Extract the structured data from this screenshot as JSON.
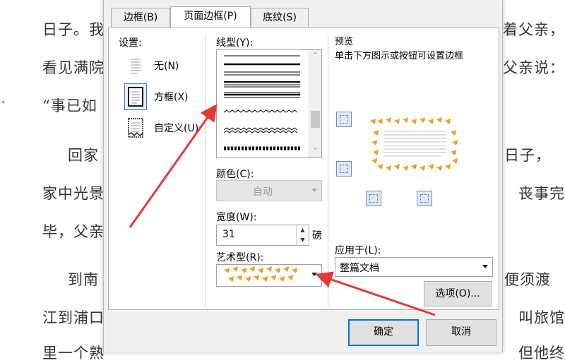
{
  "background_doc": {
    "lines": [
      {
        "left": "日子。我",
        "right": "着父亲，"
      },
      {
        "left": "看见满院",
        "right": "父亲说："
      },
      {
        "left": "“事已如",
        "right": ""
      },
      {
        "left": "回家",
        "right": "日子，"
      },
      {
        "left": "家中光景",
        "right": "丧事完"
      },
      {
        "left": "毕，父亲",
        "right": ""
      },
      {
        "left": "到南",
        "right": "便须渡"
      },
      {
        "left": "江到浦口",
        "right": "叫旅馆"
      },
      {
        "left": "里一个熟",
        "right": "但他终"
      }
    ]
  },
  "tabs": [
    {
      "label": "边框(B)",
      "active": false
    },
    {
      "label": "页面边框(P)",
      "active": true
    },
    {
      "label": "底纹(S)",
      "active": false
    }
  ],
  "settings": {
    "title": "设置:",
    "items": [
      {
        "label": "无(N)",
        "icon": "none-border-icon",
        "selected": false
      },
      {
        "label": "方框(X)",
        "icon": "box-border-icon",
        "selected": true
      },
      {
        "label": "自定义(U)",
        "icon": "custom-border-icon",
        "selected": false
      }
    ]
  },
  "style": {
    "line_label": "线型(Y):",
    "color_label": "颜色(C):",
    "color_value": "自动",
    "width_label": "宽度(W):",
    "width_value": "31",
    "width_unit": "磅",
    "art_label": "艺术型(R):"
  },
  "preview": {
    "title": "预览",
    "hint": "单击下方图示或按钮可设置边框"
  },
  "apply": {
    "label": "应用于(L):",
    "value": "整篇文档"
  },
  "buttons": {
    "options": "选项(O)...",
    "ok": "确定",
    "cancel": "取消"
  },
  "colors": {
    "annotation_arrow": "#e53935",
    "candy_orange": "#f5a623",
    "candy_dark": "#c0392b",
    "selected_border": "#3b72c0"
  }
}
